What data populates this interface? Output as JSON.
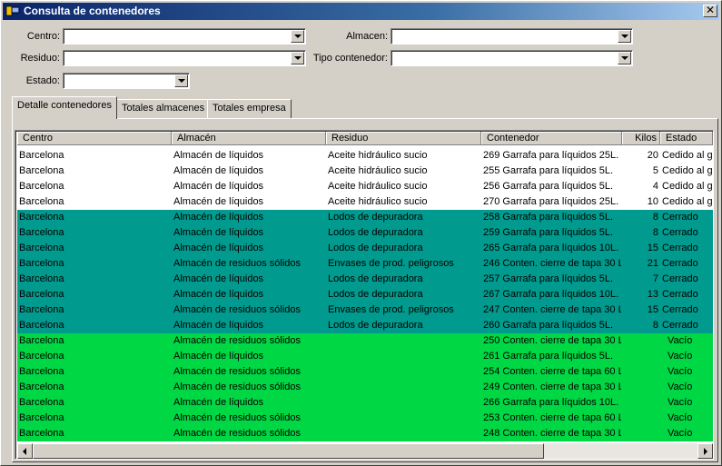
{
  "window": {
    "title": "Consulta de contenedores"
  },
  "filters": {
    "centro_label": "Centro:",
    "almacen_label": "Almacen:",
    "residuo_label": "Residuo:",
    "tipo_label": "Tipo contenedor:",
    "estado_label": "Estado:",
    "centro_value": "",
    "almacen_value": "",
    "residuo_value": "",
    "tipo_value": "",
    "estado_value": ""
  },
  "tabs": [
    {
      "label": "Detalle contenedores",
      "active": true
    },
    {
      "label": "Totales almacenes",
      "active": false
    },
    {
      "label": "Totales empresa",
      "active": false
    }
  ],
  "table": {
    "columns": [
      "Centro",
      "Almacén",
      "Residuo",
      "Contenedor",
      "Kilos",
      "Estado"
    ],
    "colors": {
      "white": "#ffffff",
      "teal": "#009b8e",
      "green": "#00d744"
    },
    "rows": [
      {
        "centro": "Barcelona",
        "almacen": "Almacén de líquidos",
        "residuo": "Aceite hidráulico sucio",
        "contenedor": "269 Garrafa para líquidos 25L.",
        "kilos": "20",
        "estado": "Cedido al g",
        "color": "white"
      },
      {
        "centro": "Barcelona",
        "almacen": "Almacén de líquidos",
        "residuo": "Aceite hidráulico sucio",
        "contenedor": "255 Garrafa para líquidos 5L.",
        "kilos": "5",
        "estado": "Cedido al g",
        "color": "white"
      },
      {
        "centro": "Barcelona",
        "almacen": "Almacén de líquidos",
        "residuo": "Aceite hidráulico sucio",
        "contenedor": "256 Garrafa para líquidos 5L.",
        "kilos": "4",
        "estado": "Cedido al g",
        "color": "white"
      },
      {
        "centro": "Barcelona",
        "almacen": "Almacén de líquidos",
        "residuo": "Aceite hidráulico sucio",
        "contenedor": "270 Garrafa para líquidos 25L.",
        "kilos": "10",
        "estado": "Cedido al g",
        "color": "white"
      },
      {
        "centro": "Barcelona",
        "almacen": "Almacén de líquidos",
        "residuo": "Lodos de depuradora",
        "contenedor": "258 Garrafa para líquidos 5L.",
        "kilos": "8",
        "estado": "Cerrado",
        "color": "teal"
      },
      {
        "centro": "Barcelona",
        "almacen": "Almacén de líquidos",
        "residuo": "Lodos de depuradora",
        "contenedor": "259 Garrafa para líquidos 5L.",
        "kilos": "8",
        "estado": "Cerrado",
        "color": "teal"
      },
      {
        "centro": "Barcelona",
        "almacen": "Almacén de líquidos",
        "residuo": "Lodos de depuradora",
        "contenedor": "265 Garrafa para líquidos 10L.",
        "kilos": "15",
        "estado": "Cerrado",
        "color": "teal"
      },
      {
        "centro": "Barcelona",
        "almacen": "Almacén de residuos sólidos",
        "residuo": "Envases de prod. peligrosos",
        "contenedor": "246 Conten. cierre de tapa 30 L",
        "kilos": "21",
        "estado": "Cerrado",
        "color": "teal"
      },
      {
        "centro": "Barcelona",
        "almacen": "Almacén de líquidos",
        "residuo": "Lodos de depuradora",
        "contenedor": "257 Garrafa para líquidos 5L.",
        "kilos": "7",
        "estado": "Cerrado",
        "color": "teal"
      },
      {
        "centro": "Barcelona",
        "almacen": "Almacén de líquidos",
        "residuo": "Lodos de depuradora",
        "contenedor": "267 Garrafa para líquidos 10L.",
        "kilos": "13",
        "estado": "Cerrado",
        "color": "teal"
      },
      {
        "centro": "Barcelona",
        "almacen": "Almacén de residuos sólidos",
        "residuo": "Envases de prod. peligrosos",
        "contenedor": "247 Conten. cierre de tapa 30 L",
        "kilos": "15",
        "estado": "Cerrado",
        "color": "teal"
      },
      {
        "centro": "Barcelona",
        "almacen": "Almacén de líquidos",
        "residuo": "Lodos de depuradora",
        "contenedor": "260 Garrafa para líquidos 5L.",
        "kilos": "8",
        "estado": "Cerrado",
        "color": "teal"
      },
      {
        "centro": "Barcelona",
        "almacen": "Almacén de residuos sólidos",
        "residuo": "",
        "contenedor": "250 Conten. cierre de tapa 30 L",
        "kilos": "",
        "estado": "Vacío",
        "color": "green"
      },
      {
        "centro": "Barcelona",
        "almacen": "Almacén de líquidos",
        "residuo": "",
        "contenedor": "261 Garrafa para líquidos 5L.",
        "kilos": "",
        "estado": "Vacío",
        "color": "green"
      },
      {
        "centro": "Barcelona",
        "almacen": "Almacén de residuos sólidos",
        "residuo": "",
        "contenedor": "254 Conten. cierre de tapa 60 L",
        "kilos": "",
        "estado": "Vacío",
        "color": "green"
      },
      {
        "centro": "Barcelona",
        "almacen": "Almacén de residuos sólidos",
        "residuo": "",
        "contenedor": "249 Conten. cierre de tapa 30 L",
        "kilos": "",
        "estado": "Vacío",
        "color": "green"
      },
      {
        "centro": "Barcelona",
        "almacen": "Almacén de líquidos",
        "residuo": "",
        "contenedor": "266 Garrafa para líquidos 10L.",
        "kilos": "",
        "estado": "Vacío",
        "color": "green"
      },
      {
        "centro": "Barcelona",
        "almacen": "Almacén de residuos sólidos",
        "residuo": "",
        "contenedor": "253 Conten. cierre de tapa 60 L",
        "kilos": "",
        "estado": "Vacío",
        "color": "green"
      },
      {
        "centro": "Barcelona",
        "almacen": "Almacén de residuos sólidos",
        "residuo": "",
        "contenedor": "248 Conten. cierre de tapa 30 L",
        "kilos": "",
        "estado": "Vacío",
        "color": "green"
      }
    ]
  }
}
